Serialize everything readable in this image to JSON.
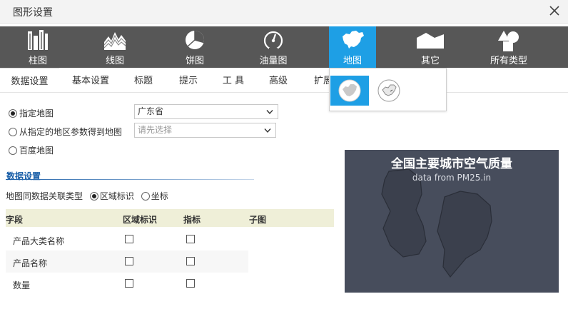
{
  "window": {
    "title": "图形设置"
  },
  "toolbar": {
    "items": [
      {
        "label": "柱图",
        "icon": "bar-chart-icon"
      },
      {
        "label": "线图",
        "icon": "line-chart-icon"
      },
      {
        "label": "饼图",
        "icon": "pie-chart-icon"
      },
      {
        "label": "油量图",
        "icon": "gauge-icon"
      },
      {
        "label": "地图",
        "icon": "map-china-icon",
        "active": true
      },
      {
        "label": "其它",
        "icon": "area-shape-icon"
      },
      {
        "label": "所有类型",
        "icon": "shapes-icon"
      }
    ],
    "active_color": "#1e9fe5",
    "bg_color": "#575757"
  },
  "map_subtypes": [
    {
      "icon": "china-map-circle-icon",
      "selected": true
    },
    {
      "icon": "china-map-outline-icon",
      "selected": false
    }
  ],
  "tabs": [
    {
      "label": "数据设置",
      "active": true
    },
    {
      "label": "基本设置"
    },
    {
      "label": "标题"
    },
    {
      "label": "提示"
    },
    {
      "label": "工 具"
    },
    {
      "label": "高级"
    },
    {
      "label": "扩展"
    }
  ],
  "map_source": {
    "opt_specified": "指定地图",
    "specified_value": "广东省",
    "opt_from_param": "从指定的地区参数得到地图",
    "param_placeholder": "请先选择",
    "opt_baidu": "百度地图",
    "selected": "specified"
  },
  "data_settings": {
    "section_title": "数据设置",
    "assoc_label": "地图同数据关联类型",
    "assoc_opt_region": "区域标识",
    "assoc_opt_coord": "坐标",
    "assoc_selected": "region",
    "columns": [
      "字段",
      "区域标识",
      "指标",
      "子图"
    ],
    "rows": [
      {
        "field": "产品大类名称",
        "region": false,
        "metric": false
      },
      {
        "field": "产品名称",
        "region": false,
        "metric": false
      },
      {
        "field": "数量",
        "region": false,
        "metric": false
      }
    ]
  },
  "preview": {
    "title": "全国主要城市空气质量",
    "subtitle": "data from PM25.in",
    "bg_color": "#474d5c"
  }
}
